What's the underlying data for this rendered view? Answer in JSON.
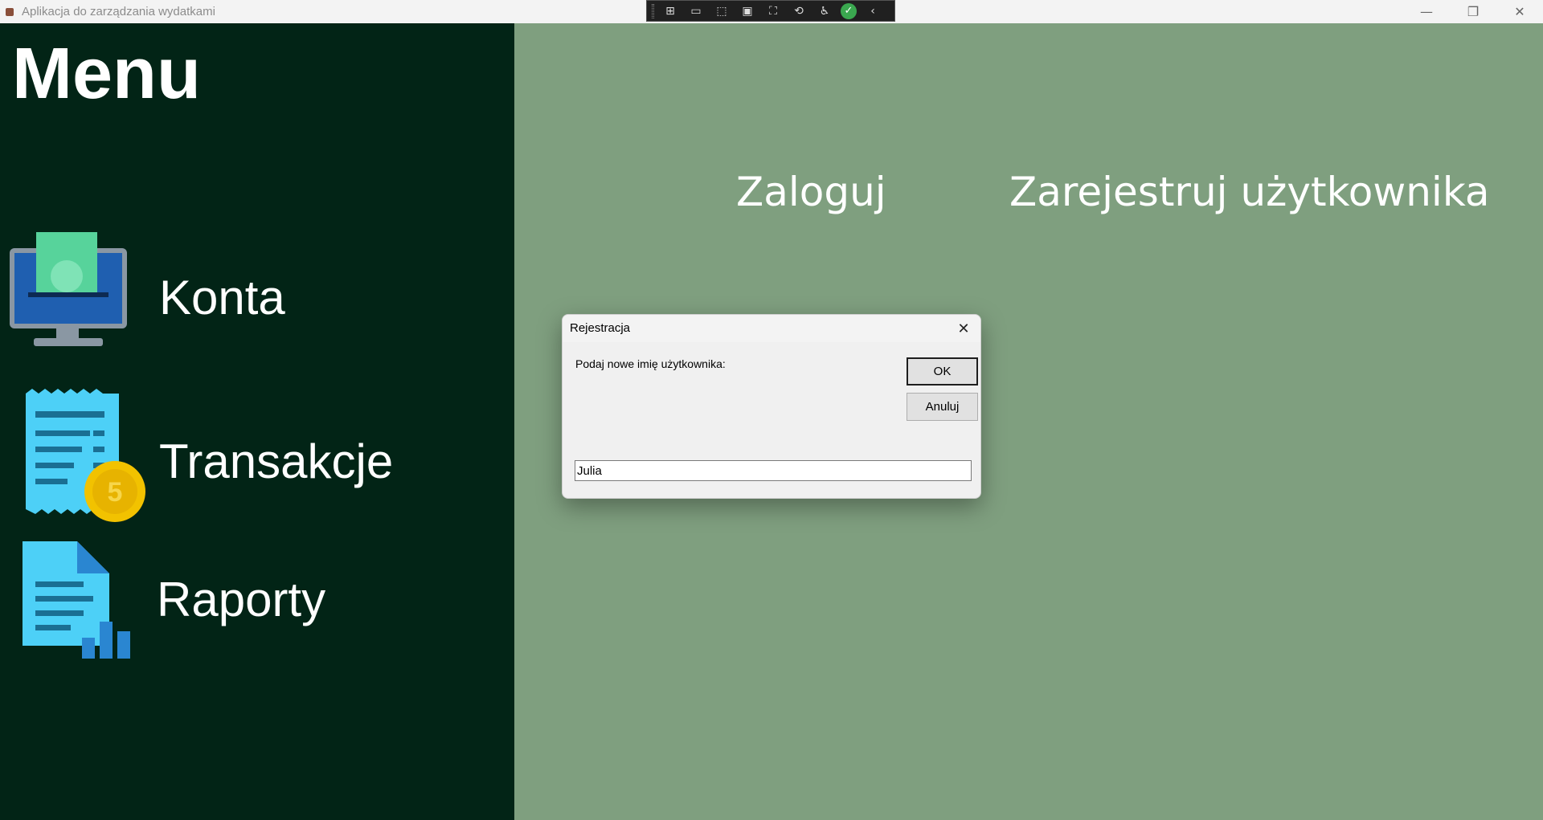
{
  "window": {
    "title": "Aplikacja do zarządzania wydatkami",
    "minimize": "—",
    "maximize": "❐",
    "close": "✕"
  },
  "debug_toolbar": {
    "tools": [
      {
        "icon": "live-visual-tree-icon",
        "glyph": "⊞"
      },
      {
        "icon": "video-icon",
        "glyph": "▭"
      },
      {
        "icon": "select-element-icon",
        "glyph": "⬚"
      },
      {
        "icon": "display-layout-adorners-icon",
        "glyph": "▣"
      },
      {
        "icon": "track-focus-icon",
        "glyph": "⛶"
      },
      {
        "icon": "hot-reload-icon",
        "glyph": "⟲"
      },
      {
        "icon": "accessibility-icon",
        "glyph": "♿"
      }
    ],
    "check": "✓",
    "collapse": "‹"
  },
  "sidebar": {
    "title": "Menu",
    "items": [
      {
        "label": "Konta",
        "icon": "accounts-monitor-icon"
      },
      {
        "label": "Transakcje",
        "icon": "transactions-receipt-icon"
      },
      {
        "label": "Raporty",
        "icon": "reports-document-icon"
      }
    ]
  },
  "main": {
    "login_label": "Zaloguj",
    "register_label": "Zarejestruj użytkownika"
  },
  "dialog": {
    "title": "Rejestracja",
    "close_glyph": "✕",
    "prompt": "Podaj nowe imię użytkownika:",
    "ok_label": "OK",
    "cancel_label": "Anuluj",
    "input_value": "Julia",
    "coin_label": "5"
  },
  "colors": {
    "sidebar_bg": "#022416",
    "main_bg": "#7f9f7f",
    "icon_cyan": "#4dd0f7",
    "coin_gold": "#f2c200"
  }
}
